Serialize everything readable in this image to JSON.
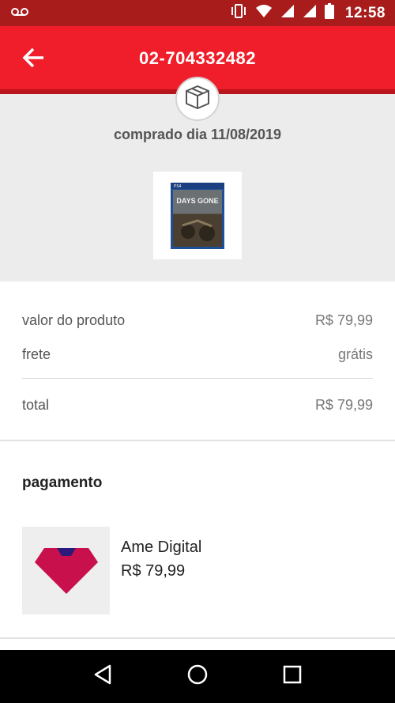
{
  "status_bar": {
    "time": "12:58",
    "icons": [
      "voicemail-icon",
      "vibrate-icon",
      "wifi-icon",
      "signal-icon",
      "signal-icon",
      "battery-icon"
    ],
    "background": "#a81c1c"
  },
  "app_bar": {
    "title": "02-704332482",
    "back_icon": "arrow-back-icon",
    "background": "#f01e2a"
  },
  "order": {
    "status_icon": "box-icon",
    "date_text": "comprado dia 11/08/2019",
    "product_image_text": "DAYS GONE",
    "product_platform": "PS4"
  },
  "prices": {
    "product_label": "valor do produto",
    "product_value": "R$ 79,99",
    "shipping_label": "frete",
    "shipping_value": "grátis",
    "total_label": "total",
    "total_value": "R$ 79,99"
  },
  "payment": {
    "title": "pagamento",
    "method": "Ame Digital",
    "amount": "R$ 79,99",
    "logo_colors": {
      "primary": "#c8104d",
      "accent": "#2b1a7a"
    }
  },
  "nav_bar": {
    "buttons": [
      "back-triangle-icon",
      "home-circle-icon",
      "recents-square-icon"
    ]
  }
}
